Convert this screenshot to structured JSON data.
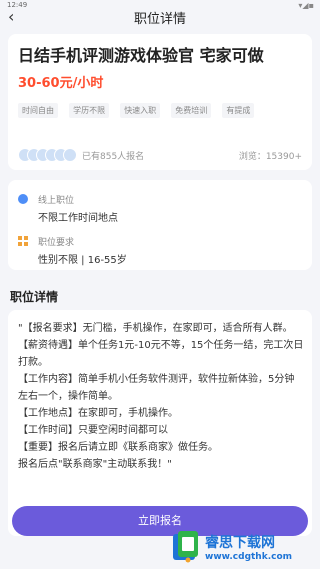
{
  "status_bar": {
    "time": "12:49",
    "icons": "▾◢▪"
  },
  "nav": {
    "back_icon": "chevron-left-icon",
    "back_glyph": "‹",
    "title": "职位详情"
  },
  "job": {
    "title": "日结手机评测游戏体验官 宅家可做",
    "salary": "30-60元/小时",
    "tags": [
      "时间自由",
      "学历不限",
      "快速入职",
      "免费培训",
      "有提成"
    ],
    "applicants": "已有855人报名",
    "views": "浏览：15390+"
  },
  "info": {
    "location_label": "线上职位",
    "location_value": "不限工作时间地点",
    "requirement_label": "职位要求",
    "requirement_value": "性别不限 | 16-55岁"
  },
  "details": {
    "section_title": "职位详情",
    "lines": [
      "\"【报名要求】无门槛，手机操作，在家即可，适合所有人群。",
      "【薪资待遇】单个任务1元-10元不等，15个任务一结，完工次日打款。",
      "【工作内容】简单手机小任务软件测评，软件拉新体验，5分钟左右一个，操作简单。",
      "【工作地点】在家即可，手机操作。",
      "【工作时间】只要空闲时间都可以",
      "【重要】报名后请立即《联系商家》做任务。",
      "报名后点\"联系商家\"主动联系我！\""
    ]
  },
  "apply_button": "立即报名",
  "watermark": {
    "name": "睿思下载网",
    "url": "www.cdgthk.com"
  },
  "colors": {
    "salary": "#ff4d2e",
    "button": "#6b5bdb",
    "location_icon": "#4e8ef7",
    "requirement_icon": "#f1a33a"
  }
}
